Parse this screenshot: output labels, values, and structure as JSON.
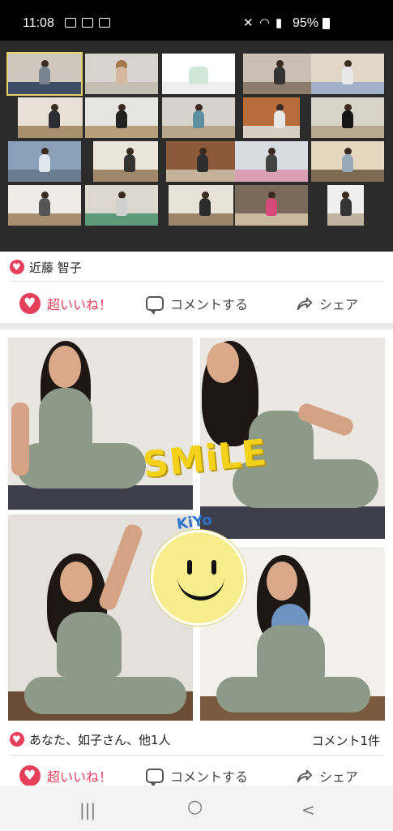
{
  "status_bar": {
    "time": "11:08",
    "battery": "95%",
    "left_icons": [
      "image-icon",
      "mail-icon",
      "voicemail-icon"
    ],
    "right_icons": [
      "mute-icon",
      "wifi-icon",
      "signal-icon",
      "battery-icon"
    ]
  },
  "post1": {
    "reactors": "近藤 智子",
    "like_label": "超いいね！",
    "comment_label": "コメントする",
    "share_label": "シェア"
  },
  "post2": {
    "collage_text": "SMiLE",
    "collage_subtext": "KiYo",
    "reactors": "あなた、如子さん、他1人",
    "comment_count": "コメント1件",
    "like_label": "超いいね！",
    "comment_label": "コメントする",
    "share_label": "シェア"
  },
  "colors": {
    "accent": "#e63f5a",
    "video_bg": "#2b2b2b",
    "outfit": "#8e9a88",
    "smile_yellow": "#f4d21c"
  },
  "nav": {
    "recents": "|||",
    "home": "○",
    "back": "<"
  }
}
